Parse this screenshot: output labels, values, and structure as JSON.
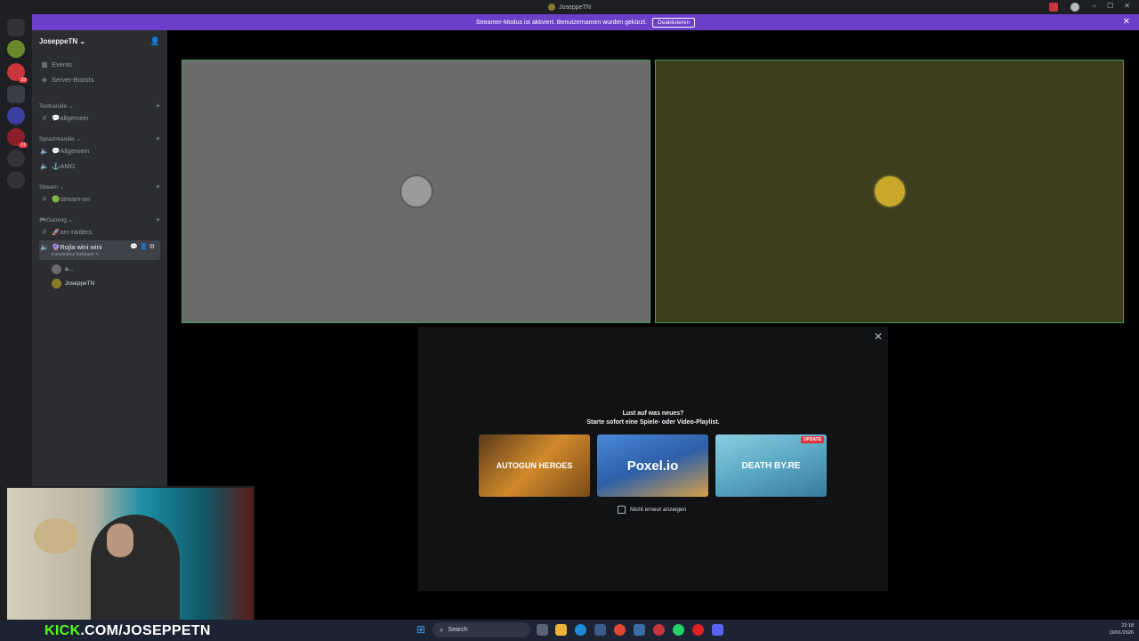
{
  "window": {
    "title": "JoseppeTN"
  },
  "banner": {
    "text": "Streamer-Modus ist aktiviert. Benutzernamen wurden gekürzt.",
    "button": "Deaktivieren"
  },
  "guild": {
    "name": "JoseppeTN ⌄"
  },
  "channels": {
    "events": "Events",
    "boosts": "Server-Boosts",
    "cat_text": "Textkanäle ⌄",
    "general_text": "💬allgemein",
    "cat_voice": "Sprachkanäle ⌄",
    "voice_general": "💬Allgemein",
    "voice_amg": "⚓AMG",
    "cat_stream": "Stream ⌄",
    "stream_on": "🟢stream-on",
    "cat_gaming": "🎮Gaming ⌄",
    "arc_raiders": "🚀arc-raiders",
    "active_voice": "🔮Rojla wini wini",
    "active_voice_sub": "Kanalstatus festlegen ✎",
    "voice_user_1": "a...",
    "voice_user_2": "JoseppeTN"
  },
  "popup": {
    "title": "Lust auf was neues?",
    "subtitle": "Starte sofort eine Spiele- oder Video-Playlist.",
    "games": [
      {
        "name": "AUTOGUN HEROES",
        "color": "#b8862b"
      },
      {
        "name": "Poxel.io",
        "color": "#3b6fb8"
      },
      {
        "name": "DEATH BY.RE",
        "color": "#6fb4cf",
        "badge": "UPDATE"
      }
    ],
    "checkbox_label": "Nicht erneut anzeigen"
  },
  "overlay": {
    "kick_prefix": "KICK",
    "kick_rest": ".COM/JOSEPPETN"
  },
  "taskbar": {
    "search": "Search",
    "time": "23:18",
    "date": "19/01/2026"
  },
  "colors": {
    "tile_left": "#6b6b6b",
    "tile_right": "#3e3e1f",
    "speaking_border": "#3ba55d",
    "banner": "#6b3fc7"
  }
}
